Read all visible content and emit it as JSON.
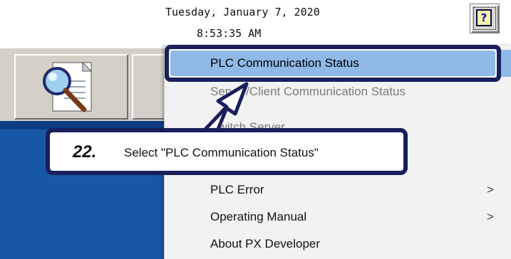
{
  "header": {
    "date": "Tuesday, January 7, 2020",
    "time": "8:53:35 AM",
    "help_icon": "help-book-icon"
  },
  "toolbar": {
    "buttons": [
      {
        "icon": "magnifier-document-icon"
      },
      {
        "icon": "partial-toolbar-button"
      }
    ]
  },
  "context_menu": {
    "items": [
      {
        "label": "PLC Communication Status",
        "selected": true,
        "submenu": false
      },
      {
        "label": "Server/Client Communication Status",
        "selected": false,
        "submenu": false
      },
      {
        "label": "Switch Server",
        "selected": false,
        "submenu": false
      },
      {
        "label": "",
        "selected": false,
        "submenu": false
      },
      {
        "label": "PLC Error",
        "selected": false,
        "submenu": true
      },
      {
        "label": "Operating Manual",
        "selected": false,
        "submenu": true
      },
      {
        "label": "About PX Developer",
        "selected": false,
        "submenu": false
      }
    ],
    "submenu_arrow": ">"
  },
  "callout": {
    "step": "22.",
    "text": "Select \"PLC Communication Status\""
  },
  "colors": {
    "highlight": "#8fb9e6",
    "outline": "#1a1f5c",
    "desktop": "#1857a6"
  }
}
